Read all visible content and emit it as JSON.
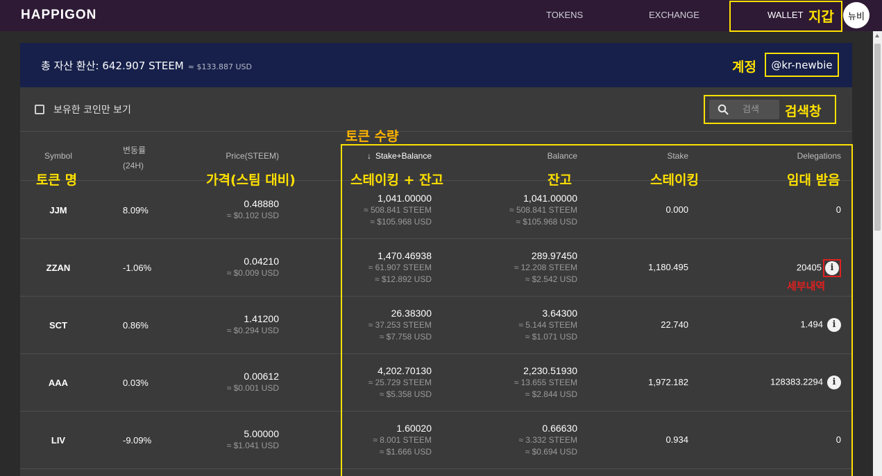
{
  "nav": {
    "logo": "HAPPIGON",
    "tokens": "TOKENS",
    "exchange": "EXCHANGE",
    "wallet": "WALLET",
    "avatar": "뉴비"
  },
  "summary": {
    "total": "총 자산 환산: 642.907 STEEM",
    "total_usd": "≈ $133.887 USD",
    "account": "@kr-newbie"
  },
  "filter": {
    "owned_only": "보유한 코인만 보기",
    "search_placeholder": "검색"
  },
  "headers": {
    "symbol": "Symbol",
    "change_line1": "변동률",
    "change_line2": "(24H)",
    "price": "Price(STEEM)",
    "stake_balance": "Stake+Balance",
    "balance": "Balance",
    "stake": "Stake",
    "delegations": "Delegations"
  },
  "annotations": {
    "wallet": "지갑",
    "account": "계정",
    "search": "검색창",
    "token_amount": "토큰 수량",
    "token_name": "토큰 명",
    "price": "가격(스팀 대비)",
    "stake_balance": "스테이킹 + 잔고",
    "balance": "잔고",
    "staking": "스테이킹",
    "delegation": "임대 받음",
    "details": "세부내역"
  },
  "rows": [
    {
      "symbol": "JJM",
      "change": "8.09%",
      "price": "0.48880",
      "price_usd": "≈ $0.102 USD",
      "sb": "1,041.00000",
      "sb_steem": "≈ 508.841 STEEM",
      "sb_usd": "≈ $105.968 USD",
      "bal": "1,041.00000",
      "bal_steem": "≈ 508.841 STEEM",
      "bal_usd": "≈ $105.968 USD",
      "stake": "0.000",
      "deleg": "0"
    },
    {
      "symbol": "ZZAN",
      "change": "-1.06%",
      "price": "0.04210",
      "price_usd": "≈ $0.009 USD",
      "sb": "1,470.46938",
      "sb_steem": "≈ 61.907 STEEM",
      "sb_usd": "≈ $12.892 USD",
      "bal": "289.97450",
      "bal_steem": "≈ 12.208 STEEM",
      "bal_usd": "≈ $2.542 USD",
      "stake": "1,180.495",
      "deleg": "20405"
    },
    {
      "symbol": "SCT",
      "change": "0.86%",
      "price": "1.41200",
      "price_usd": "≈ $0.294 USD",
      "sb": "26.38300",
      "sb_steem": "≈ 37.253 STEEM",
      "sb_usd": "≈ $7.758 USD",
      "bal": "3.64300",
      "bal_steem": "≈ 5.144 STEEM",
      "bal_usd": "≈ $1.071 USD",
      "stake": "22.740",
      "deleg": "1.494"
    },
    {
      "symbol": "AAA",
      "change": "0.03%",
      "price": "0.00612",
      "price_usd": "≈ $0.001 USD",
      "sb": "4,202.70130",
      "sb_steem": "≈ 25.729 STEEM",
      "sb_usd": "≈ $5.358 USD",
      "bal": "2,230.51930",
      "bal_steem": "≈ 13.655 STEEM",
      "bal_usd": "≈ $2.844 USD",
      "stake": "1,972.182",
      "deleg": "128383.2294"
    },
    {
      "symbol": "LIV",
      "change": "-9.09%",
      "price": "5.00000",
      "price_usd": "≈ $1.041 USD",
      "sb": "1.60020",
      "sb_steem": "≈ 8.001 STEEM",
      "sb_usd": "≈ $1.666 USD",
      "bal": "0.66630",
      "bal_steem": "≈ 3.332 STEEM",
      "bal_usd": "≈ $0.694 USD",
      "stake": "0.934",
      "deleg": "0"
    }
  ],
  "colors": {
    "nav_bg": "#2e1a35",
    "summary_bg": "#16204a",
    "annotation_yellow": "#ffe100",
    "annotation_orange": "#ffb400",
    "annotation_red": "#e02020"
  }
}
